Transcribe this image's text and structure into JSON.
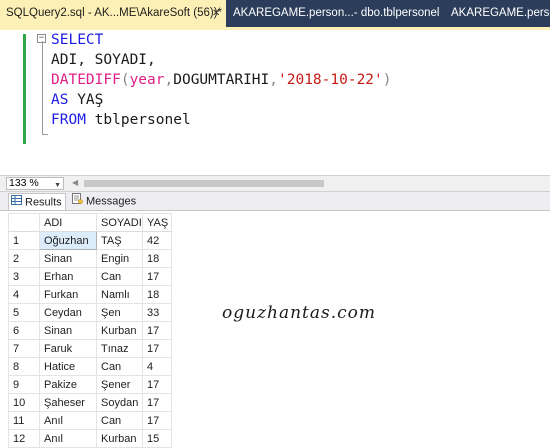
{
  "tabs": [
    {
      "label": "SQLQuery2.sql - AK...ME\\AkareSoft (56))*",
      "close": "✕"
    },
    {
      "label": "AKAREGAME.person...- dbo.tblpersonel"
    },
    {
      "label": "AKAREGAME.person..."
    }
  ],
  "editor": {
    "lines": {
      "select": "SELECT",
      "cols": "ADI, SOYADI,",
      "datediff_fn": "DATEDIFF",
      "datediff_open": "(",
      "datediff_arg1": "year",
      "datediff_comma1": ",",
      "datediff_arg2": "DOGUMTARIHI",
      "datediff_comma2": ",",
      "datediff_str": "'2018-10-22'",
      "datediff_close": ")",
      "as_kw": "AS",
      "as_alias": "YAŞ",
      "from_kw": "FROM",
      "from_table": "tblpersonel"
    },
    "fold_symbol": "−"
  },
  "zoom": {
    "value": "133 %"
  },
  "results_tabs": {
    "results": "Results",
    "messages": "Messages"
  },
  "grid": {
    "columns": [
      "ADI",
      "SOYADI",
      "YAŞ"
    ],
    "rows": [
      {
        "n": "1",
        "adi": "Oğuzhan",
        "soyadi": "TAŞ",
        "yas": "42"
      },
      {
        "n": "2",
        "adi": "Sinan",
        "soyadi": "Engin",
        "yas": "18"
      },
      {
        "n": "3",
        "adi": "Erhan",
        "soyadi": "Can",
        "yas": "17"
      },
      {
        "n": "4",
        "adi": "Furkan",
        "soyadi": "Namlı",
        "yas": "18"
      },
      {
        "n": "5",
        "adi": "Ceydan",
        "soyadi": "Şen",
        "yas": "33"
      },
      {
        "n": "6",
        "adi": "Sinan",
        "soyadi": "Kurban",
        "yas": "17"
      },
      {
        "n": "7",
        "adi": "Faruk",
        "soyadi": "Tınaz",
        "yas": "17"
      },
      {
        "n": "8",
        "adi": "Hatice",
        "soyadi": "Can",
        "yas": "4"
      },
      {
        "n": "9",
        "adi": "Pakize",
        "soyadi": "Şener",
        "yas": "17"
      },
      {
        "n": "10",
        "adi": "Şaheser",
        "soyadi": "Soydan",
        "yas": "17"
      },
      {
        "n": "11",
        "adi": "Anıl",
        "soyadi": "Can",
        "yas": "17"
      },
      {
        "n": "12",
        "adi": "Anıl",
        "soyadi": "Kurban",
        "yas": "15"
      }
    ]
  },
  "watermark": "oguzhantas.com",
  "colors": {
    "tabbar": "#2b3d5a",
    "active_tab": "#fdf0b6",
    "keyword": "#1c1ce6",
    "function": "#e0218a",
    "string": "#c41a16",
    "gutter_changed": "#2ea74a"
  }
}
